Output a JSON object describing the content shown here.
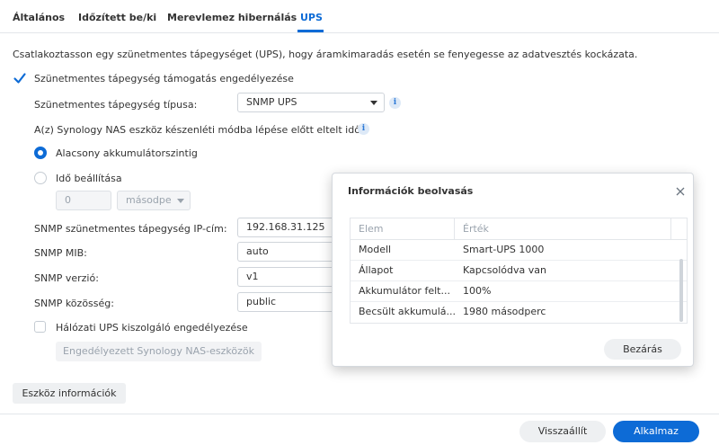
{
  "tabs": [
    {
      "label": "Általános",
      "active": false
    },
    {
      "label": "Időzített be/ki",
      "active": false
    },
    {
      "label": "Merevlemez hibernálás",
      "active": false
    },
    {
      "label": "UPS",
      "active": true
    }
  ],
  "description": "Csatlakoztasson egy szünetmentes tápegységet (UPS), hogy áramkimaradás esetén se fenyegesse az adatvesztés kockázata.",
  "ups_enable": {
    "label": "Szünetmentes tápegység támogatás engedélyezése",
    "checked": true
  },
  "ups_type": {
    "label": "Szünetmentes tápegység típusa:",
    "value": "SNMP UPS"
  },
  "standby_label": "A(z) Synology NAS eszköz készenléti módba lépése előtt eltelt idő",
  "radio_low_battery": {
    "label": "Alacsony akkumulátorszintig",
    "checked": true
  },
  "radio_time": {
    "label": "Idő beállítása",
    "checked": false
  },
  "time_value": "0",
  "time_unit": "másodpe",
  "snmp_ip": {
    "label": "SNMP szünetmentes tápegység IP-cím:",
    "value": "192.168.31.125"
  },
  "snmp_mib": {
    "label": "SNMP MIB:",
    "value": "auto"
  },
  "snmp_version": {
    "label": "SNMP verzió:",
    "value": "v1"
  },
  "snmp_community": {
    "label": "SNMP közösség:",
    "value": "public"
  },
  "network_ups": {
    "label": "Hálózati UPS kiszolgáló engedélyezése",
    "checked": false
  },
  "allowed_devices_button": "Engedélyezett Synology NAS-eszközök",
  "device_info_button": "Eszköz információk",
  "reset_button": "Visszaállít",
  "apply_button": "Alkalmaz",
  "dialog": {
    "title": "Információk beolvasás",
    "columns": [
      "Elem",
      "Érték"
    ],
    "rows": [
      {
        "item": "Modell",
        "value": "Smart-UPS 1000"
      },
      {
        "item": "Állapot",
        "value": "Kapcsolódva van"
      },
      {
        "item": "Akkumulátor felt...",
        "value": "100%"
      },
      {
        "item": "Becsült akkumulá...",
        "value": "1980 másodperc"
      }
    ],
    "close_button": "Bezárás"
  },
  "colors": {
    "accent": "#0d6bd6",
    "border": "#cfd4da"
  }
}
